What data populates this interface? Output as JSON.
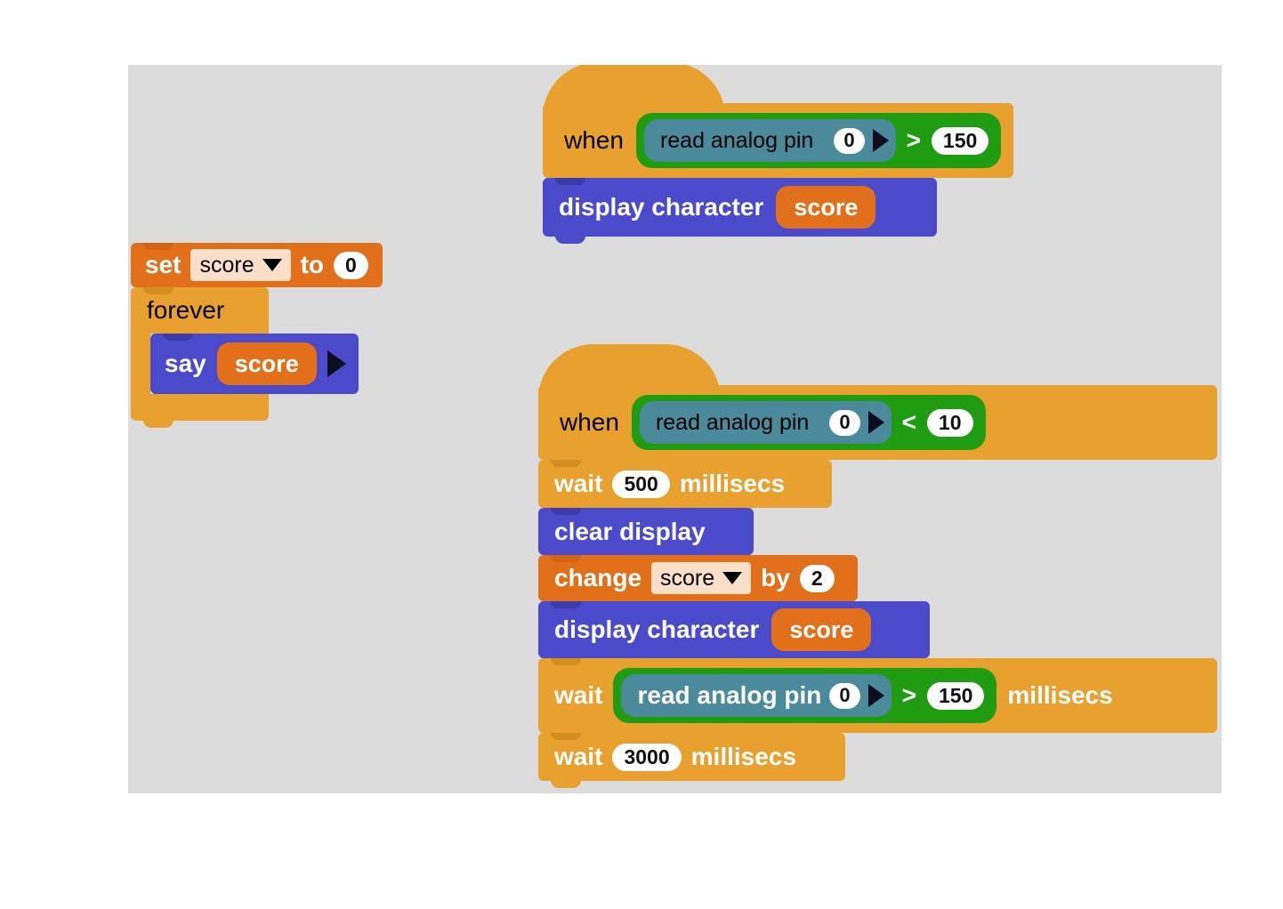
{
  "canvas": {
    "background": "#dcdcdc"
  },
  "palette": {
    "control": "#e8a02e",
    "data": "#e2701a",
    "looks": "#4a4acb",
    "boolean": "#1f9c12",
    "reporter": "#4a8a9a",
    "dropdown_field": "#fbdfc8",
    "input_oval": "#ffffff"
  },
  "scripts": {
    "script_variables": {
      "set_block": {
        "label": "set",
        "variable": "score",
        "to_label": "to",
        "value": "0"
      },
      "forever_block": {
        "label": "forever"
      },
      "say_block": {
        "label": "say",
        "variable": "score"
      }
    },
    "script_display_on_high": {
      "hat": {
        "when_label": "when",
        "condition": {
          "reporter_label": "read analog pin",
          "pin": "0",
          "operator": ">",
          "threshold": "150"
        }
      },
      "body": [
        {
          "label": "display character",
          "variable": "score"
        }
      ]
    },
    "script_score_on_low": {
      "hat": {
        "when_label": "when",
        "condition": {
          "reporter_label": "read analog pin",
          "pin": "0",
          "operator": "<",
          "threshold": "10"
        }
      },
      "body": [
        {
          "type": "wait",
          "label": "wait",
          "value": "500",
          "units": "millisecs"
        },
        {
          "type": "clear",
          "label": "clear display"
        },
        {
          "type": "change",
          "label": "change",
          "variable": "score",
          "by_label": "by",
          "value": "2"
        },
        {
          "type": "display",
          "label": "display character",
          "variable": "score"
        },
        {
          "type": "wait_reporter",
          "label": "wait",
          "units": "millisecs",
          "condition": {
            "reporter_label": "read analog pin",
            "pin": "0",
            "operator": ">",
            "threshold": "150"
          }
        },
        {
          "type": "wait",
          "label": "wait",
          "value": "3000",
          "units": "millisecs"
        }
      ]
    }
  }
}
